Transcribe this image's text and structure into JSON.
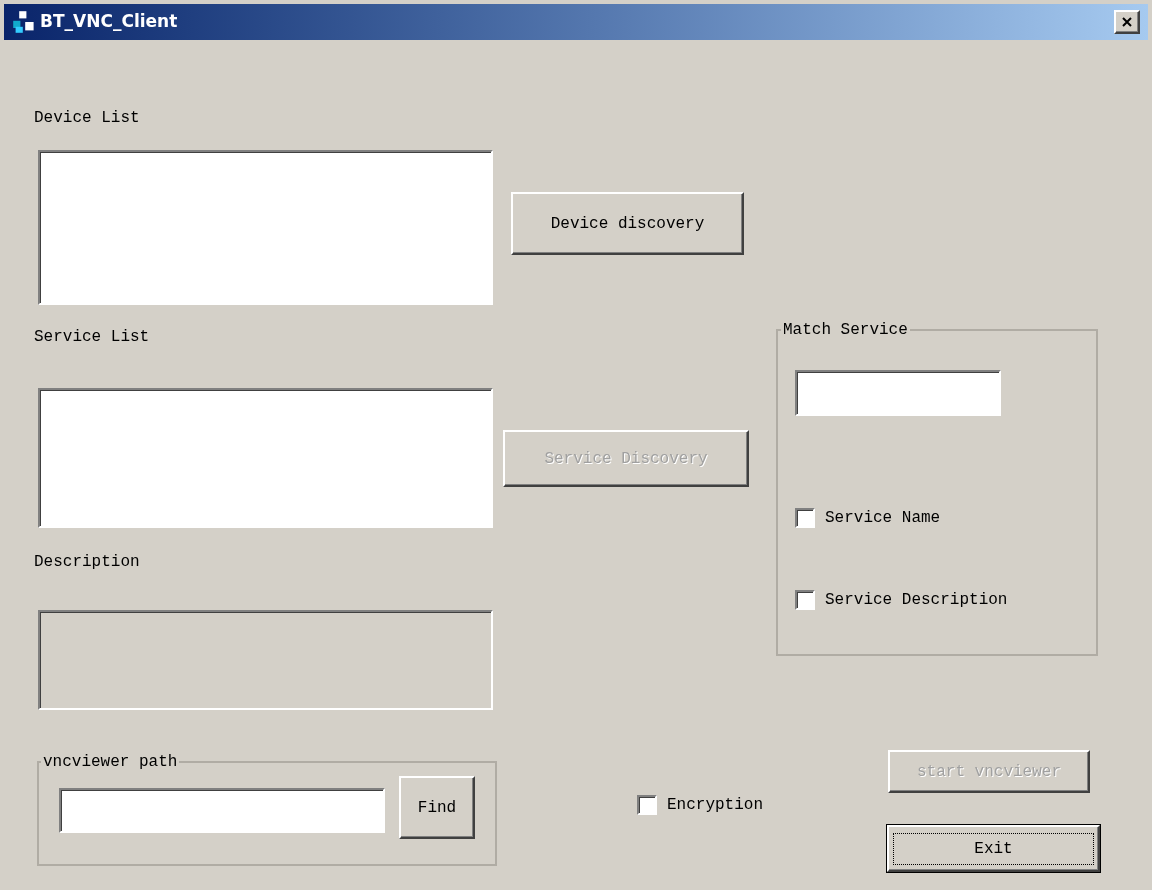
{
  "window": {
    "title": "BT_VNC_Client"
  },
  "device_list": {
    "label": "Device List"
  },
  "device_discovery_button": {
    "label": "Device discovery",
    "disabled": false
  },
  "service_list": {
    "label": "Service List"
  },
  "service_discovery_button": {
    "label": "Service Discovery",
    "disabled": true
  },
  "description": {
    "label": "Description",
    "disabled": true
  },
  "match_service": {
    "title": "Match Service",
    "checkboxes": [
      {
        "label": "Service Name",
        "checked": false
      },
      {
        "label": "Service Description",
        "checked": false
      }
    ]
  },
  "vncviewer_path": {
    "title": "vncviewer path",
    "button": "Find"
  },
  "encryption": {
    "label": "Encryption",
    "checked": false
  },
  "start_button": {
    "label": "start vncviewer",
    "disabled": true
  },
  "exit_button": {
    "label": "Exit",
    "default": true
  }
}
